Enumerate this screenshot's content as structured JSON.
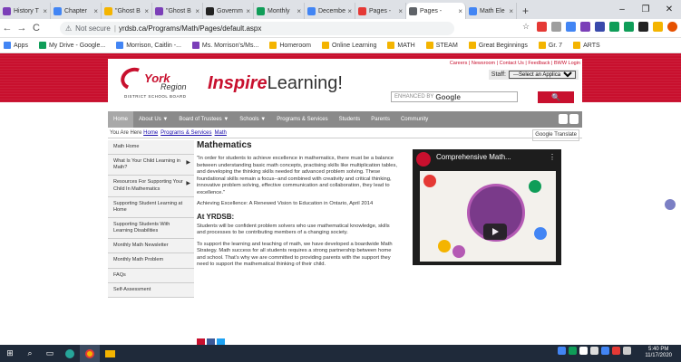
{
  "browser": {
    "tabs": [
      {
        "label": "History T",
        "color": "#7b3fb8"
      },
      {
        "label": "Chapter",
        "color": "#4285f4"
      },
      {
        "label": "\"Ghost B",
        "color": "#f4b400"
      },
      {
        "label": "\"Ghost B",
        "color": "#7b3fb8"
      },
      {
        "label": "Governm",
        "color": "#222222"
      },
      {
        "label": "Monthly",
        "color": "#0f9d58"
      },
      {
        "label": "Decembe",
        "color": "#4285f4"
      },
      {
        "label": "Pages -",
        "color": "#e53935"
      },
      {
        "label": "Pages -",
        "color": "#5f6368"
      },
      {
        "label": "Math Ele",
        "color": "#4285f4"
      }
    ],
    "new_tab": "+",
    "window_controls": [
      "–",
      "❐",
      "✕"
    ],
    "security_label": "Not secure",
    "url": "yrdsb.ca/Programs/Math/Pages/default.aspx",
    "bookmarks": [
      {
        "label": "Apps",
        "color": "#4285f4"
      },
      {
        "label": "My Drive - Google...",
        "color": "#0f9d58"
      },
      {
        "label": "Morrison, Caitlin -...",
        "color": "#4285f4"
      },
      {
        "label": "Ms. Morrison's/Ms...",
        "color": "#7b3fb8"
      },
      {
        "label": "Homeroom",
        "color": "#f4b400"
      },
      {
        "label": "Online Learning",
        "color": "#f4b400"
      },
      {
        "label": "MATH",
        "color": "#f4b400"
      },
      {
        "label": "STEAM",
        "color": "#f4b400"
      },
      {
        "label": "Great Beginnings",
        "color": "#f4b400"
      },
      {
        "label": "Gr. 7",
        "color": "#f4b400"
      },
      {
        "label": "ARTS",
        "color": "#f4b400"
      }
    ]
  },
  "site": {
    "logo": {
      "york": "York",
      "region": "Region",
      "board": "DISTRICT SCHOOL BOARD"
    },
    "brand_inspire": "Inspire",
    "brand_learning": "Learning!",
    "top_links": "Careers | Newsroom | Contact Us | Feedback | BWW Login",
    "staff_label": "Staff:",
    "staff_select": "---Select an Application---",
    "search_prefix": "ENHANCED BY",
    "search_brand": "Google",
    "search_button": "🔍",
    "nav": [
      "Home",
      "About Us ▼",
      "Board of Trustees ▼",
      "Schools ▼",
      "Programs & Services",
      "Students",
      "Parents",
      "Community"
    ],
    "crumbs_prefix": "You Are Here",
    "crumbs": [
      "Home",
      "Programs & Services",
      "Math"
    ],
    "translate": "Google Translate",
    "accent": "#c8102e"
  },
  "sidebar": {
    "items": [
      {
        "label": "Math Home",
        "arrow": ""
      },
      {
        "label": "What Is Your Child Learning in Math?",
        "arrow": "▶"
      },
      {
        "label": "Resources For Supporting Your Child In Mathematics",
        "arrow": "▶"
      },
      {
        "label": "Supporting Student Learning at Home",
        "arrow": ""
      },
      {
        "label": "Supporting Students With Learning Disabilities",
        "arrow": ""
      },
      {
        "label": "Monthly Math Newsletter",
        "arrow": ""
      },
      {
        "label": "Monthly Math Problem",
        "arrow": ""
      },
      {
        "label": "FAQs",
        "arrow": ""
      },
      {
        "label": "Self-Assessment",
        "arrow": ""
      }
    ]
  },
  "main": {
    "title": "Mathematics",
    "quote": "\"In order for students to achieve excellence in mathematics, there must be a balance between understanding basic math concepts, practising skills like multiplication tables, and developing the thinking skills needed for advanced problem solving. These foundational skills remain a focus--and combined with creativity and critical thinking, innovative problem solving, effective communication and collaboration, they lead to excellence.\"",
    "source": "Achieving Excellence: A Renewed Vision to Education in Ontario, April 2014",
    "subhead": "At YRDSB:",
    "para1": "Students will be confident problem solvers who use mathematical knowledge, skills and processes to be contributing members of a changing society.",
    "para2": "To support the learning and teaching of math, we have developed a boardwide Math Strategy. Math success for all students requires a strong partnership between home and school. That's why we are committed to providing parents with the support they need to support the mathematical thinking of their child.",
    "video_title": "Comprehensive Math...",
    "video_menu": "⋮"
  },
  "taskbar": {
    "time": "5:40 PM",
    "date": "11/17/2020"
  }
}
